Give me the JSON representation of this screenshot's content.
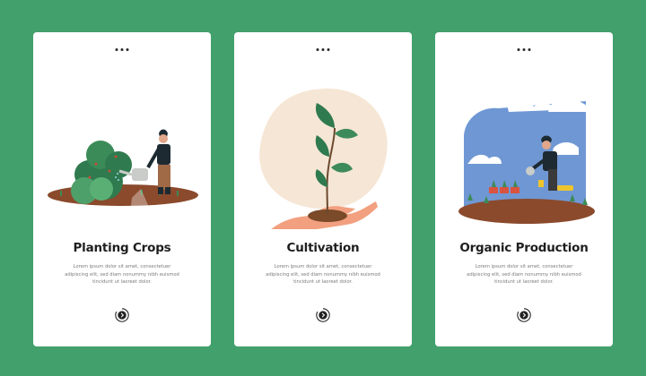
{
  "screens": [
    {
      "title": "Planting Crops",
      "body": "Lorem ipsum dolor sit amet, consectetuer adipiscing elit, sed diam nonummy nibh euismod tincidunt ut laoreet dolor.",
      "illustration": "gardener-watering-plants"
    },
    {
      "title": "Cultivation",
      "body": "Lorem ipsum dolor sit amet, consectetuer adipiscing elit, sed diam nonummy nibh euismod tincidunt ut laoreet dolor.",
      "illustration": "hand-holding-sprout"
    },
    {
      "title": "Organic Production",
      "body": "Lorem ipsum dolor sit amet, consectetuer adipiscing elit, sed diam nonummy nibh euismod tincidunt ut laoreet dolor.",
      "illustration": "farmer-planting-seedlings"
    }
  ],
  "icons": {
    "next": "next-arrow-icon",
    "pager": "pager-dots-icon"
  },
  "colors": {
    "background": "#42a06c",
    "card": "#ffffff",
    "title": "#1e1e1e",
    "body": "#7b7b7b",
    "soil": "#8b4a2c",
    "leaf": "#2f7a4e",
    "sky": "#6f97d4"
  }
}
